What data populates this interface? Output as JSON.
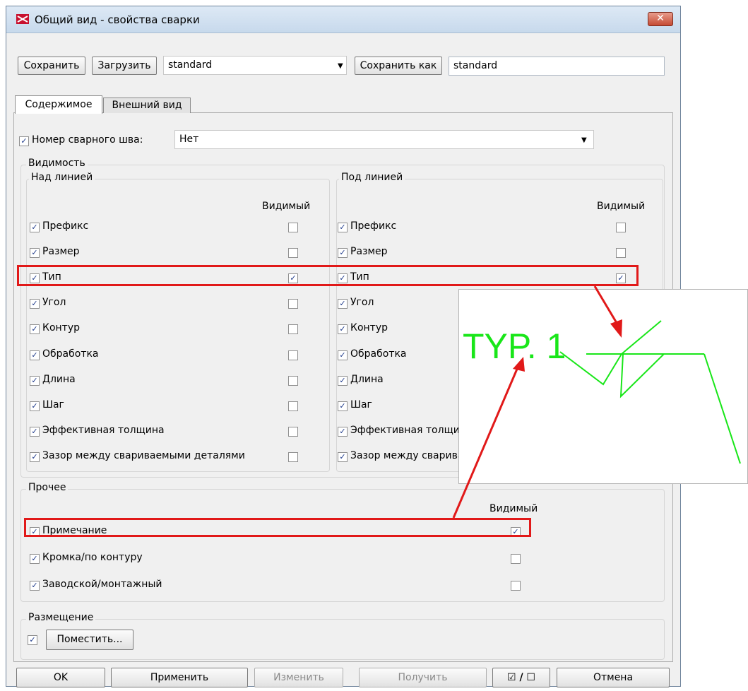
{
  "window": {
    "title": "Общий вид - свойства сварки",
    "close_glyph": "✕"
  },
  "toolbar": {
    "save_label": "Сохранить",
    "load_label": "Загрузить",
    "settings_value": "standard",
    "save_as_label": "Сохранить как",
    "save_as_value": "standard"
  },
  "tabs": [
    {
      "label": "Содержимое",
      "active": true
    },
    {
      "label": "Внешний вид",
      "active": false
    }
  ],
  "weld_number": {
    "label": "Номер сварного шва:",
    "checked": true,
    "value": "Нет"
  },
  "visibility": {
    "title": "Видимость",
    "above": {
      "title": "Над линией",
      "visible_header": "Видимый",
      "rows": [
        {
          "label": "Префикс",
          "checked": true,
          "visible": false
        },
        {
          "label": "Размер",
          "checked": true,
          "visible": false
        },
        {
          "label": "Тип",
          "checked": true,
          "visible": true
        },
        {
          "label": "Угол",
          "checked": true,
          "visible": false
        },
        {
          "label": "Контур",
          "checked": true,
          "visible": false
        },
        {
          "label": "Обработка",
          "checked": true,
          "visible": false
        },
        {
          "label": "Длина",
          "checked": true,
          "visible": false
        },
        {
          "label": "Шаг",
          "checked": true,
          "visible": false
        },
        {
          "label": "Эффективная толщина",
          "checked": true,
          "visible": false
        },
        {
          "label": "Зазор между свариваемыми деталями",
          "checked": true,
          "visible": false
        }
      ]
    },
    "below": {
      "title": "Под линией",
      "visible_header": "Видимый",
      "rows": [
        {
          "label": "Префикс",
          "checked": true,
          "visible": false
        },
        {
          "label": "Размер",
          "checked": true,
          "visible": false
        },
        {
          "label": "Тип",
          "checked": true,
          "visible": true
        },
        {
          "label": "Угол",
          "checked": true
        },
        {
          "label": "Контур",
          "checked": true
        },
        {
          "label": "Обработка",
          "checked": true
        },
        {
          "label": "Длина",
          "checked": true
        },
        {
          "label": "Шаг",
          "checked": true
        },
        {
          "label": "Эффективная толщина",
          "checked": true
        },
        {
          "label": "Зазор между сваривамыми деталями",
          "checked": true
        }
      ]
    }
  },
  "other": {
    "title": "Прочее",
    "visible_header": "Видимый",
    "rows": [
      {
        "label": "Примечание",
        "checked": true,
        "visible": true
      },
      {
        "label": "Кромка/по контуру",
        "checked": true,
        "visible": false
      },
      {
        "label": "Заводской/монтажный",
        "checked": true,
        "visible": false
      }
    ]
  },
  "placement": {
    "title": "Размещение",
    "checked": true,
    "place_label": "Поместить..."
  },
  "bottom_buttons": {
    "ok": "OK",
    "apply": "Применить",
    "modify": "Изменить",
    "get": "Получить",
    "toggle": "☑ / ☐",
    "cancel": "Отмена"
  },
  "zoom": {
    "text": "TYP. 1"
  },
  "colors": {
    "highlight": "#e11919",
    "zoom_line": "#19e619"
  },
  "check_glyph": "✓"
}
